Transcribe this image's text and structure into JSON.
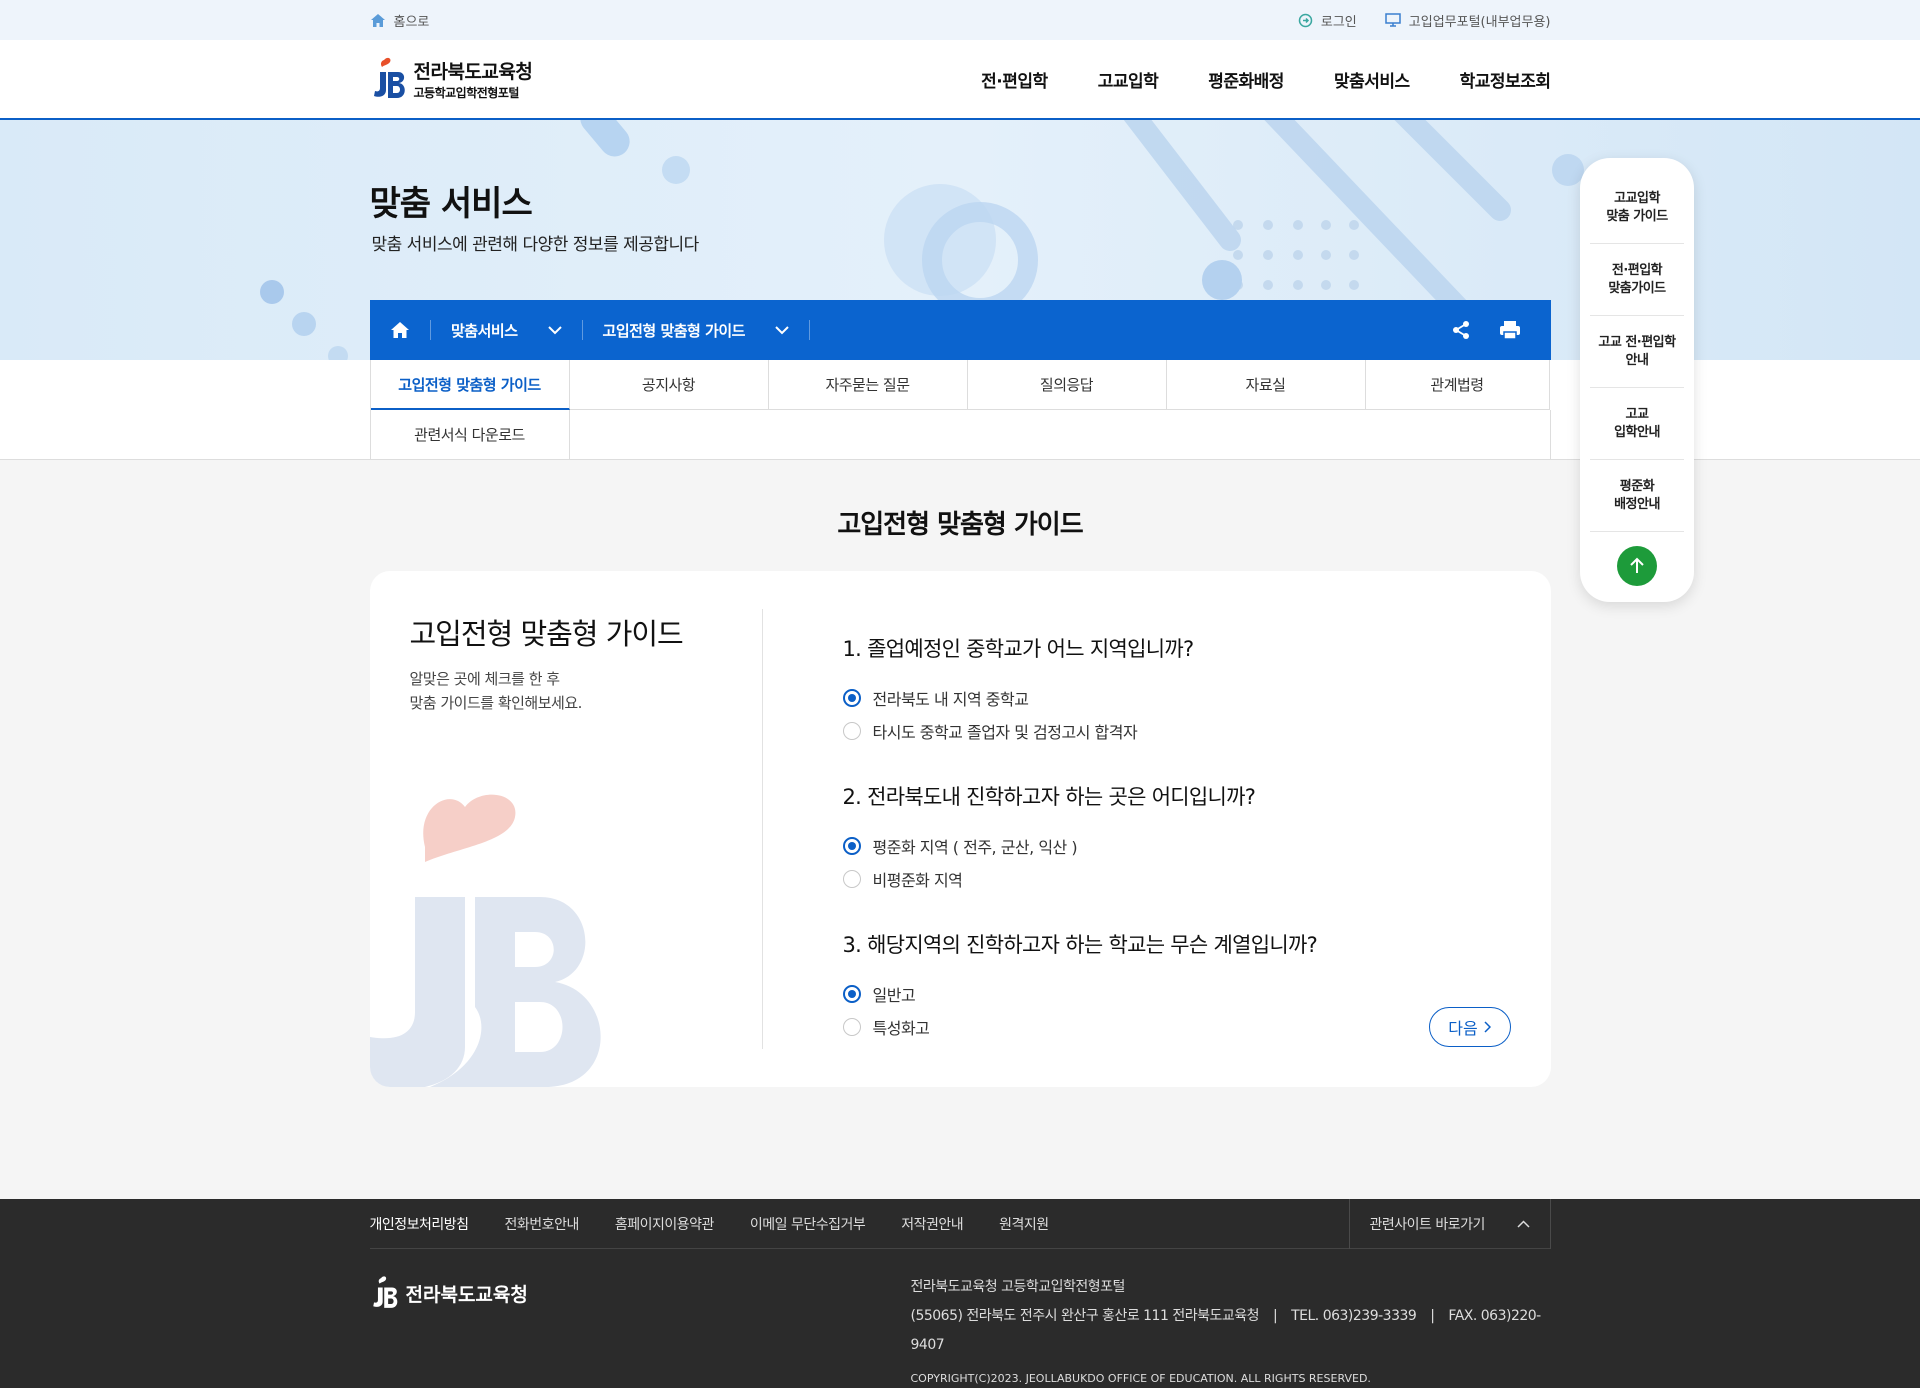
{
  "util": {
    "home": "홈으로",
    "login": "로그인",
    "portal": "고입업무포털(내부업무용)"
  },
  "header": {
    "logo_name": "전라북도교육청",
    "logo_sub": "고등학교입학전형포털",
    "nav": [
      "전·편입학",
      "고교입학",
      "평준화배정",
      "맞춤서비스",
      "학교정보조회"
    ]
  },
  "visual": {
    "title": "맞춤 서비스",
    "desc": "맞춤 서비스에 관련해 다양한 정보를 제공합니다"
  },
  "location": {
    "crumb1": "맞춤서비스",
    "crumb2": "고입전형 맞춤형 가이드"
  },
  "tabs": [
    "고입전형 맞춤형 가이드",
    "공지사항",
    "자주묻는 질문",
    "질의응답",
    "자료실",
    "관계법령",
    "관련서식 다운로드"
  ],
  "content": {
    "title": "고입전형 맞춤형 가이드",
    "card_title": "고입전형 맞춤형 가이드",
    "card_desc1": "알맞은 곳에 체크를 한 후",
    "card_desc2": "맞춤 가이드를 확인해보세요.",
    "questions": [
      {
        "q": "1. 졸업예정인 중학교가 어느 지역입니까?",
        "options": [
          "전라북도 내 지역 중학교",
          "타시도 중학교 졸업자 및 검정고시 합격자"
        ],
        "selected": 0
      },
      {
        "q": "2. 전라북도내 진학하고자 하는 곳은 어디입니까?",
        "options": [
          "평준화 지역 ( 전주, 군산, 익산 )",
          "비평준화 지역"
        ],
        "selected": 0
      },
      {
        "q": "3. 해당지역의 진학하고자 하는 학교는 무슨 계열입니까?",
        "options": [
          "일반고",
          "특성화고"
        ],
        "selected": 0
      }
    ],
    "next": "다음"
  },
  "quick": [
    "고교입학\n맞춤 가이드",
    "전·편입학\n맞춤가이드",
    "고교 전·편입학\n안내",
    "고교\n입학안내",
    "평준화\n배정안내"
  ],
  "footer": {
    "links": [
      "개인정보처리방침",
      "전화번호안내",
      "홈페이지이용약관",
      "이메일 무단수집거부",
      "저작권안내",
      "원격지원"
    ],
    "related": "관련사이트 바로가기",
    "logo": "전라북도교육청",
    "org": "전라북도교육청 고등학교입학전형포털",
    "address": "(55065) 전라북도 전주시 완산구 홍산로 111 전라북도교육청",
    "tel": "TEL. 063)239-3339",
    "fax": "FAX. 063)220-9407",
    "copyright": "COPYRIGHT(C)2023. JEOLLABUKDO OFFICE OF EDUCATION. ALL RIGHTS RESERVED."
  },
  "colors": {
    "primary": "#0b64cf",
    "accent_green": "#1d9b3a",
    "footer_bg": "#2b2b2b"
  }
}
